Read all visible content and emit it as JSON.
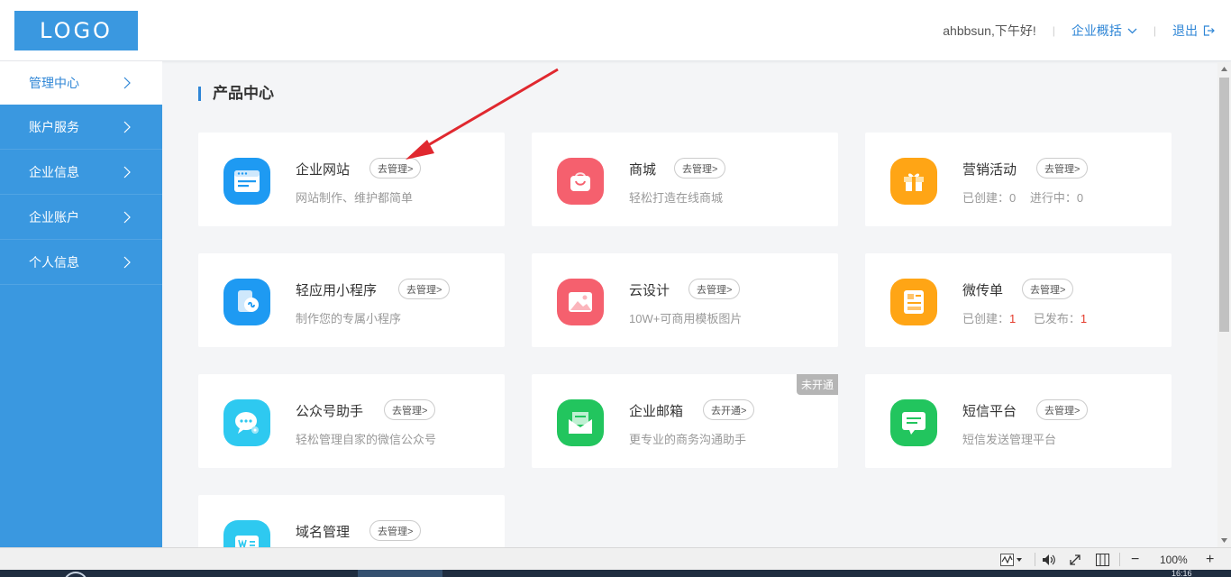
{
  "header": {
    "logo": "LOGO",
    "greeting": "ahbbsun,下午好!",
    "overview_label": "企业概括",
    "logout_label": "退出",
    "sep": "|"
  },
  "sidebar": {
    "items": [
      {
        "label": "管理中心",
        "active": true
      },
      {
        "label": "账户服务"
      },
      {
        "label": "企业信息"
      },
      {
        "label": "企业账户"
      },
      {
        "label": "个人信息"
      }
    ]
  },
  "main": {
    "section_title": "产品中心",
    "cards": [
      {
        "name": "企业网站",
        "btn": "去管理>",
        "desc": "网站制作、维护都简单",
        "icon": "website-icon"
      },
      {
        "name": "商城",
        "btn": "去管理>",
        "desc": "轻松打造在线商城",
        "icon": "shopping-bag-icon"
      },
      {
        "name": "营销活动",
        "btn": "去管理>",
        "desc_parts": [
          "已创建：",
          "0",
          "进行中：",
          "0"
        ],
        "icon": "gift-icon"
      },
      {
        "name": "轻应用小程序",
        "btn": "去管理>",
        "desc": "制作您的专属小程序",
        "icon": "mini-program-icon"
      },
      {
        "name": "云设计",
        "btn": "去管理>",
        "desc": "10W+可商用模板图片",
        "icon": "image-icon"
      },
      {
        "name": "微传单",
        "btn": "去管理>",
        "desc_parts": [
          "已创建：",
          "1",
          "已发布：",
          "1"
        ],
        "icon": "flyer-icon"
      },
      {
        "name": "公众号助手",
        "btn": "去管理>",
        "desc": "轻松管理自家的微信公众号",
        "icon": "wechat-icon"
      },
      {
        "name": "企业邮箱",
        "btn": "去开通>",
        "desc": "更专业的商务沟通助手",
        "ribbon": "未开通",
        "icon": "mail-icon"
      },
      {
        "name": "短信平台",
        "btn": "去管理>",
        "desc": "短信发送管理平台",
        "icon": "sms-icon"
      },
      {
        "name": "域名管理",
        "btn": "去管理>",
        "desc": "",
        "icon": "domain-icon"
      }
    ]
  },
  "statusbar": {
    "zoom": "100%",
    "minus": "−",
    "plus": "+"
  },
  "taskbar": {
    "clock": "16:16"
  },
  "colors": {
    "brand": "#3a98e0",
    "link": "#2f86d6",
    "blue_icon": "#1e9af2",
    "pink_icon": "#f5606e",
    "orange_icon": "#ffa515",
    "cyan_icon": "#2ec9f0",
    "green_icon": "#22c55e"
  }
}
